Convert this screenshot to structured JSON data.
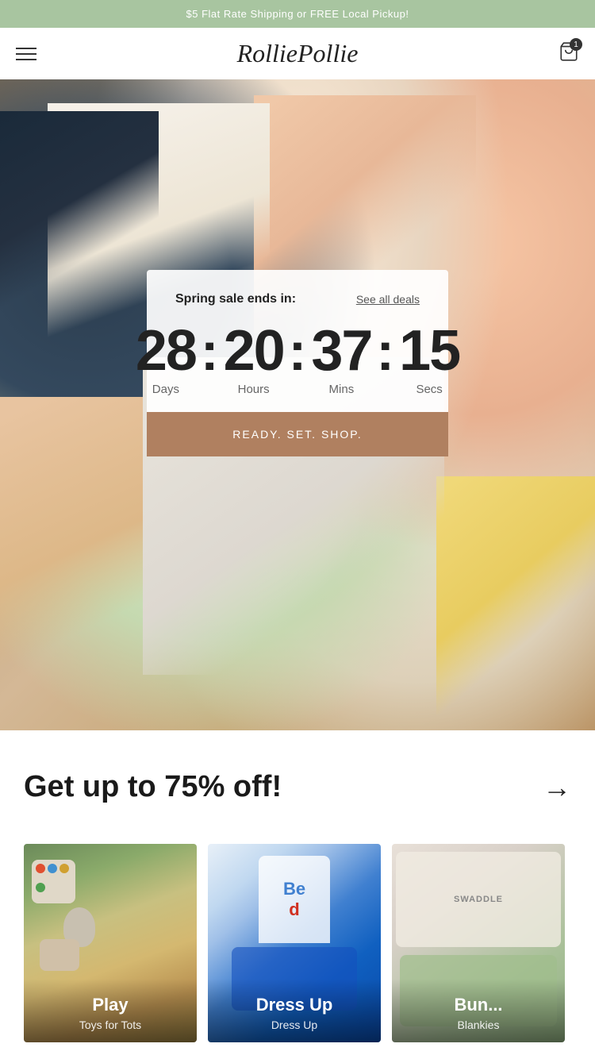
{
  "announcement": {
    "text": "$5 Flat Rate Shipping or FREE Local Pickup!"
  },
  "header": {
    "logo": "RolliePollie",
    "cart_count": "1"
  },
  "hero": {
    "countdown": {
      "title": "Spring sale ends in:",
      "see_all_deals": "See all deals",
      "days": "28",
      "hours": "20",
      "mins": "37",
      "secs": "15",
      "label_days": "Days",
      "label_hours": "Hours",
      "label_mins": "Mins",
      "label_secs": "Secs",
      "cta": "READY. SET. SHOP."
    }
  },
  "promo": {
    "text": "Get up to 75% off!"
  },
  "categories": [
    {
      "name": "Play",
      "sub": "Toys for Tots",
      "bg_class": "category-bg-play"
    },
    {
      "name": "Dress Up",
      "sub": "Dress Up",
      "bg_class": "category-bg-dressup"
    },
    {
      "name": "Bun...",
      "sub": "Blankies",
      "bg_class": "category-bg-blankies"
    }
  ]
}
